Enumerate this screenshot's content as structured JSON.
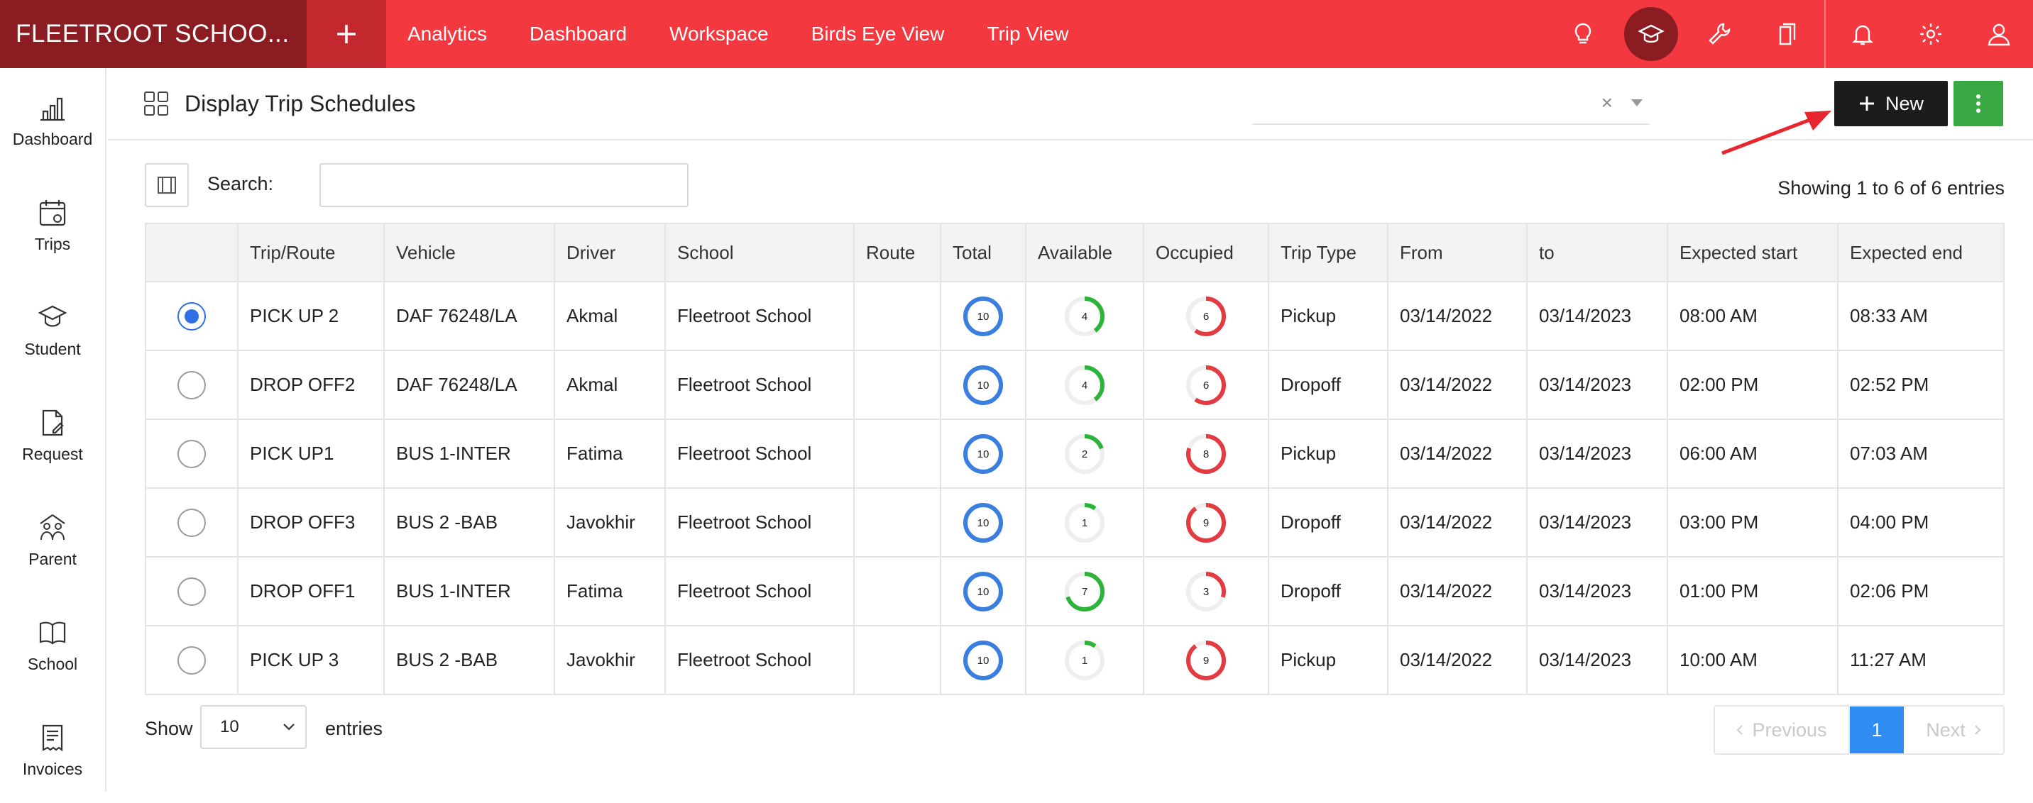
{
  "app": {
    "brand": "FLEETROOT SCHOO..."
  },
  "nav": {
    "items": [
      "Analytics",
      "Dashboard",
      "Workspace",
      "Birds Eye View",
      "Trip View"
    ]
  },
  "sidebar": {
    "items": [
      {
        "label": "Dashboard",
        "icon": "bar-chart-icon"
      },
      {
        "label": "Trips",
        "icon": "calendar-icon"
      },
      {
        "label": "Student",
        "icon": "graduation-cap-icon"
      },
      {
        "label": "Request",
        "icon": "document-edit-icon"
      },
      {
        "label": "Parent",
        "icon": "family-icon"
      },
      {
        "label": "School",
        "icon": "book-icon"
      },
      {
        "label": "Invoices",
        "icon": "invoice-icon"
      }
    ]
  },
  "page": {
    "title": "Display Trip Schedules",
    "select_clear": "×",
    "new_label": "New",
    "search_label": "Search:",
    "search_value": "",
    "showing": "Showing 1 to 6 of 6 entries"
  },
  "table": {
    "headers": [
      "Trip/Route",
      "Vehicle",
      "Driver",
      "School",
      "Route",
      "Total",
      "Available",
      "Occupied",
      "Trip Type",
      "From",
      "to",
      "Expected start",
      "Expected end"
    ],
    "rows": [
      {
        "selected": true,
        "trip": "PICK UP 2",
        "vehicle": "DAF 76248/LA",
        "driver": "Akmal",
        "school": "Fleetroot School",
        "route": "",
        "total": 10,
        "available": 4,
        "occupied": 6,
        "type": "Pickup",
        "from": "03/14/2022",
        "to": "03/14/2023",
        "start": "08:00 AM",
        "end": "08:33 AM"
      },
      {
        "selected": false,
        "trip": "DROP OFF2",
        "vehicle": "DAF 76248/LA",
        "driver": "Akmal",
        "school": "Fleetroot School",
        "route": "",
        "total": 10,
        "available": 4,
        "occupied": 6,
        "type": "Dropoff",
        "from": "03/14/2022",
        "to": "03/14/2023",
        "start": "02:00 PM",
        "end": "02:52 PM"
      },
      {
        "selected": false,
        "trip": "PICK UP1",
        "vehicle": "BUS 1-INTER",
        "driver": "Fatima",
        "school": "Fleetroot School",
        "route": "",
        "total": 10,
        "available": 2,
        "occupied": 8,
        "type": "Pickup",
        "from": "03/14/2022",
        "to": "03/14/2023",
        "start": "06:00 AM",
        "end": "07:03 AM"
      },
      {
        "selected": false,
        "trip": "DROP OFF3",
        "vehicle": "BUS 2 -BAB",
        "driver": "Javokhir",
        "school": "Fleetroot School",
        "route": "",
        "total": 10,
        "available": 1,
        "occupied": 9,
        "type": "Dropoff",
        "from": "03/14/2022",
        "to": "03/14/2023",
        "start": "03:00 PM",
        "end": "04:00 PM"
      },
      {
        "selected": false,
        "trip": "DROP OFF1",
        "vehicle": "BUS 1-INTER",
        "driver": "Fatima",
        "school": "Fleetroot School",
        "route": "",
        "total": 10,
        "available": 7,
        "occupied": 3,
        "type": "Dropoff",
        "from": "03/14/2022",
        "to": "03/14/2023",
        "start": "01:00 PM",
        "end": "02:06 PM"
      },
      {
        "selected": false,
        "trip": "PICK UP 3",
        "vehicle": "BUS 2 -BAB",
        "driver": "Javokhir",
        "school": "Fleetroot School",
        "route": "",
        "total": 10,
        "available": 1,
        "occupied": 9,
        "type": "Pickup",
        "from": "03/14/2022",
        "to": "03/14/2023",
        "start": "10:00 AM",
        "end": "11:27 AM"
      }
    ]
  },
  "footer": {
    "show_label": "Show",
    "page_size": "10",
    "entries_label": "entries",
    "prev_label": "Previous",
    "current_page": "1",
    "next_label": "Next"
  },
  "colors": {
    "brand_red": "#f4383f",
    "total": "#3a7fe0",
    "available": "#2eb33a",
    "occupied": "#e23b42",
    "track": "#eeeeee"
  }
}
